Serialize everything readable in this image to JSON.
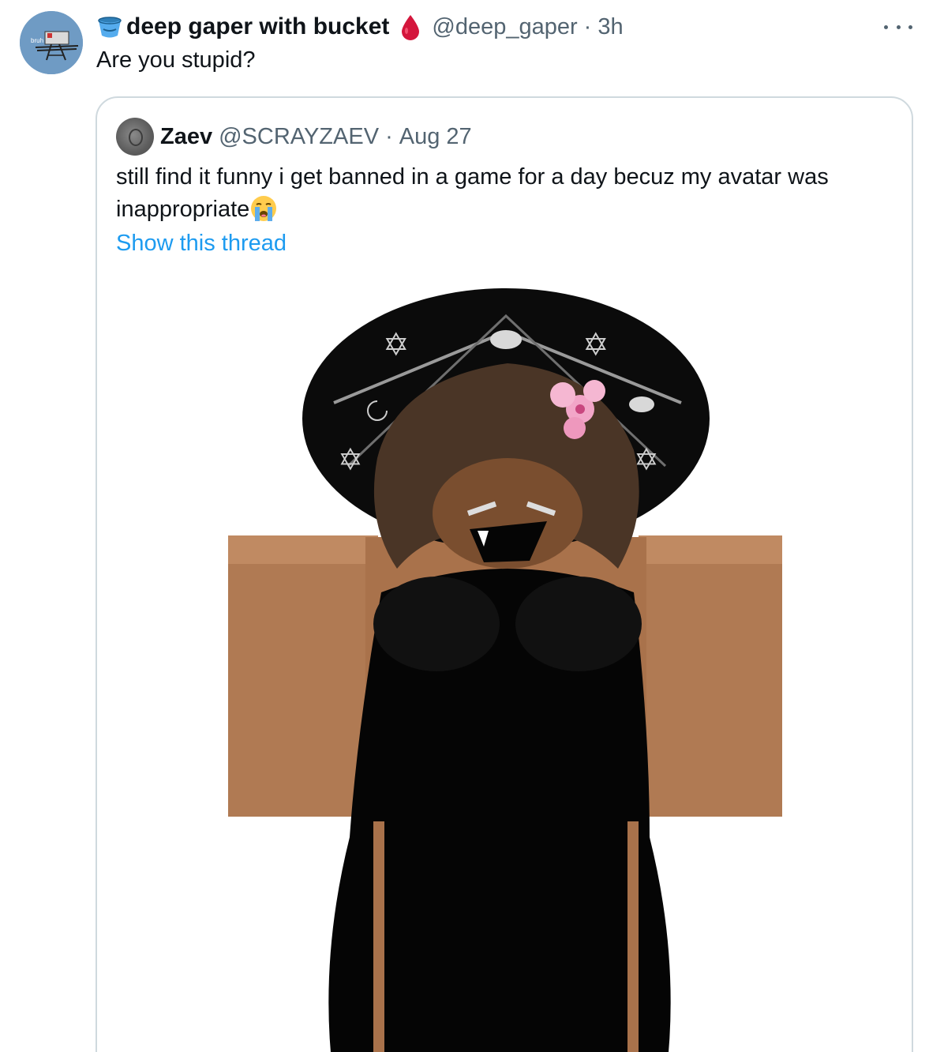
{
  "tweet": {
    "author": {
      "display_name": "deep gaper with bucket",
      "handle": "@deep_gaper",
      "time": "3h",
      "avatar_icon": "avatar-sketch-icon",
      "avatar_text": "bruh",
      "name_prefix_icon": "bucket-icon",
      "name_suffix_icon": "blood-drop-icon"
    },
    "separator": "·",
    "text": "Are you stupid?",
    "more_icon": "more-dots-icon"
  },
  "quoted": {
    "author": {
      "display_name": "Zaev",
      "handle": "@SCRAYZAEV",
      "time": "Aug 27",
      "avatar_icon": "grey-avatar-icon"
    },
    "separator": "·",
    "text": "still find it funny i get banned in a game for a day becuz my avatar was inappropriate",
    "emoji": "loudly-crying-face-icon",
    "show_thread": "Show this thread",
    "media_description_icon": "roblox-avatar-image"
  },
  "colors": {
    "secondary_text": "#536471",
    "link": "#1d9bf0",
    "border": "#cfd9de",
    "text": "#0f1419"
  }
}
